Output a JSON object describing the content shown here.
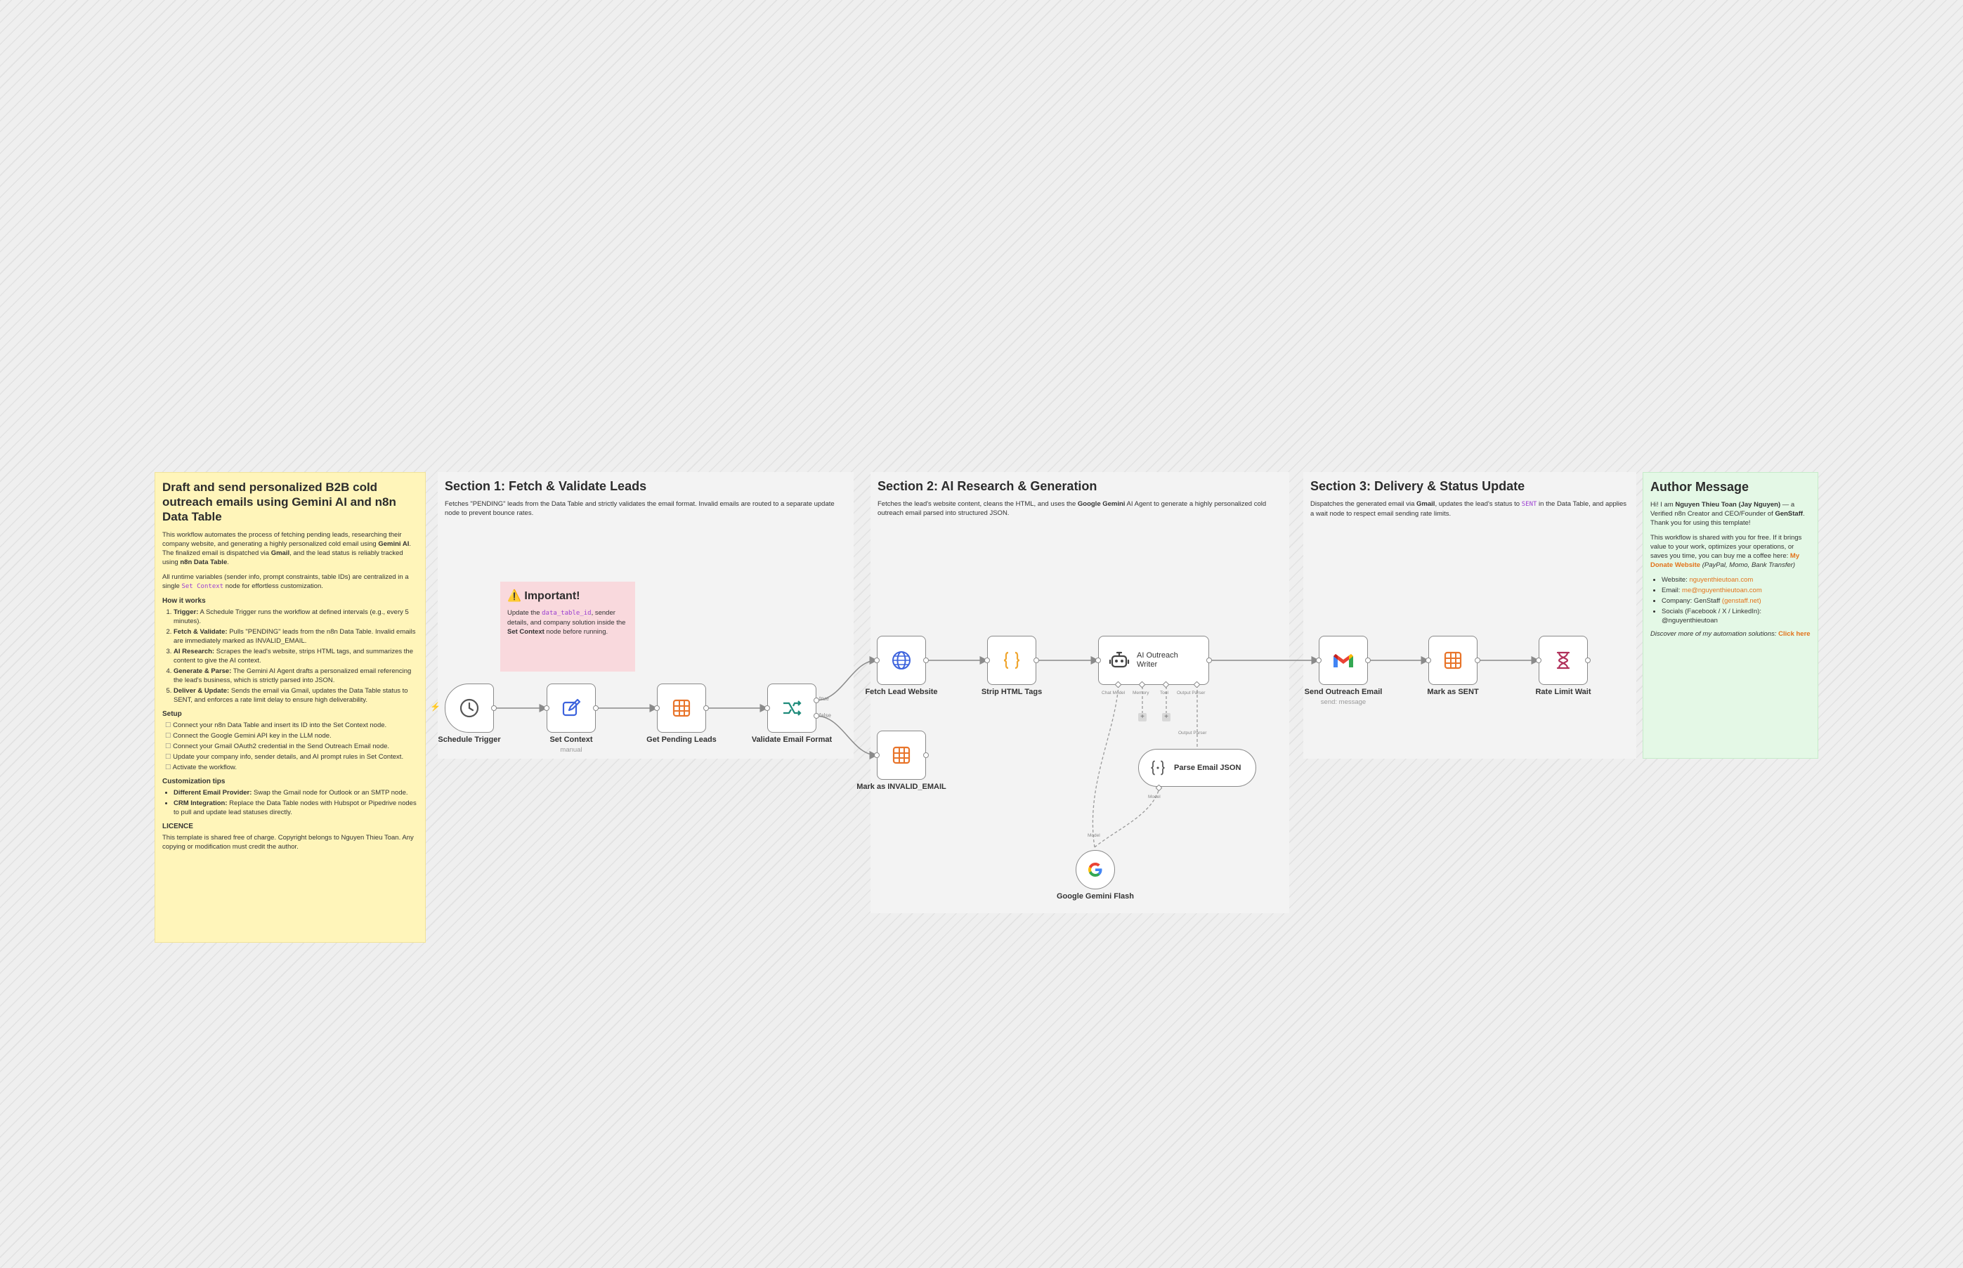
{
  "overview": {
    "title": "Draft and send personalized B2B cold outreach emails using Gemini AI and n8n Data Table",
    "p1_a": "This workflow automates the process of fetching pending leads, researching their company website, and generating a highly personalized cold email using ",
    "p1_gemini": "Gemini AI",
    "p1_b": ". The finalized email is dispatched via ",
    "p1_gmail": "Gmail",
    "p1_c": ", and the lead status is reliably tracked using ",
    "p1_table": "n8n Data Table",
    "p1_d": ".",
    "p2_a": "All runtime variables (sender info, prompt constraints, table IDs) are centralized in a single ",
    "p2_code": "Set Context",
    "p2_b": " node for effortless customization.",
    "how_title": "How it works",
    "how": [
      {
        "b": "Trigger:",
        "t": " A Schedule Trigger runs the workflow at defined intervals (e.g., every 5 minutes)."
      },
      {
        "b": "Fetch & Validate:",
        "t": " Pulls \"PENDING\" leads from the n8n Data Table. Invalid emails are immediately marked as INVALID_EMAIL."
      },
      {
        "b": "AI Research:",
        "t": " Scrapes the lead's website, strips HTML tags, and summarizes the content to give the AI context."
      },
      {
        "b": "Generate & Parse:",
        "t": " The Gemini AI Agent drafts a personalized email referencing the lead's business, which is strictly parsed into JSON."
      },
      {
        "b": "Deliver & Update:",
        "t": " Sends the email via Gmail, updates the Data Table status to SENT, and enforces a rate limit delay to ensure high deliverability."
      }
    ],
    "setup_title": "Setup",
    "setup": [
      "Connect your n8n Data Table and insert its ID into the Set Context node.",
      "Connect the Google Gemini API key in the LLM node.",
      "Connect your Gmail OAuth2 credential in the Send Outreach Email node.",
      "Update your company info, sender details, and AI prompt rules in Set Context.",
      "Activate the workflow."
    ],
    "tips_title": "Customization tips",
    "tips": [
      {
        "b": "Different Email Provider:",
        "t": " Swap the Gmail node for Outlook or an SMTP node."
      },
      {
        "b": "CRM Integration:",
        "t": " Replace the Data Table nodes with Hubspot or Pipedrive nodes to pull and update lead statuses directly."
      }
    ],
    "licence_title": "LICENCE",
    "licence": "This template is shared free of charge. Copyright belongs to Nguyen Thieu Toan. Any copying or modification must credit the author."
  },
  "section1": {
    "title": "Section 1: Fetch & Validate Leads",
    "desc": "Fetches \"PENDING\" leads from the Data Table and strictly validates the email format. Invalid emails are routed to a separate update node to prevent bounce rates."
  },
  "important": {
    "title": "⚠️ Important!",
    "a": "Update the ",
    "code": "data_table_id",
    "b": ", sender details, and company solution inside the ",
    "bold": "Set Context",
    "c": " node before running."
  },
  "section2": {
    "title": "Section 2: AI Research & Generation",
    "desc_a": "Fetches the lead's website content, cleans the HTML, and uses the ",
    "desc_bold": "Google Gemini",
    "desc_b": " AI Agent to generate a highly personalized cold outreach email parsed into structured JSON."
  },
  "section3": {
    "title": "Section 3: Delivery & Status Update",
    "desc_a": "Dispatches the generated email via ",
    "desc_bold": "Gmail",
    "desc_b": ", updates the lead's status to ",
    "desc_code": "SENT",
    "desc_c": " in the Data Table, and applies a wait node to respect email sending rate limits."
  },
  "author": {
    "title": "Author Message",
    "p1_a": "Hi! I am ",
    "p1_name": "Nguyen Thieu Toan (Jay Nguyen)",
    "p1_b": " — a Verified n8n Creator and CEO/Founder of ",
    "p1_company": "GenStaff",
    "p1_c": ". Thank you for using this template!",
    "p2_a": "This workflow is shared with you for free. If it brings value to your work, optimizes your operations, or saves you time, you can buy me a coffee here: ",
    "p2_link": "My Donate Website",
    "p2_b": " (PayPal, Momo, Bank Transfer)",
    "items": [
      {
        "k": "Website: ",
        "v": "nguyenthieutoan.com"
      },
      {
        "k": "Email: ",
        "v": "me@nguyenthieutoan.com"
      },
      {
        "k": "Company: GenStaff ",
        "v": "(genstaff.net)"
      },
      {
        "k": "Socials (Facebook / X / LinkedIn): ",
        "v": "@nguyenthieutoan"
      }
    ],
    "footer_a": "Discover more of my automation solutions: ",
    "footer_link": "Click here"
  },
  "nodes": {
    "schedule": {
      "label": "Schedule Trigger"
    },
    "set_context": {
      "label": "Set Context",
      "sub": "manual"
    },
    "get_pending": {
      "label": "Get Pending Leads"
    },
    "validate": {
      "label": "Validate Email Format",
      "true_label": "true",
      "false_label": "false"
    },
    "fetch_website": {
      "label": "Fetch Lead Website"
    },
    "mark_invalid": {
      "label": "Mark as INVALID_EMAIL"
    },
    "strip_html": {
      "label": "Strip HTML Tags"
    },
    "ai_writer": {
      "label": "AI Outreach Writer",
      "ports": [
        "Chat Model",
        "Memory",
        "Tool",
        "Output Parser"
      ]
    },
    "parse_json": {
      "label": "Parse Email JSON",
      "port_top": "Output Parser",
      "port_bottom": "Model"
    },
    "gemini": {
      "label": "Google Gemini Flash",
      "port_top": "Model"
    },
    "send_email": {
      "label": "Send Outreach Email",
      "sub": "send: message"
    },
    "mark_sent": {
      "label": "Mark as SENT"
    },
    "rate_limit": {
      "label": "Rate Limit Wait"
    }
  },
  "colors": {
    "yellow_note": "#fff5ba",
    "gray_note": "#f3f3f3",
    "green_note": "#e4f8e6",
    "pink_note": "#f9d9dd",
    "accent_orange": "#e2721a",
    "code_purple": "#9b3fd1"
  }
}
